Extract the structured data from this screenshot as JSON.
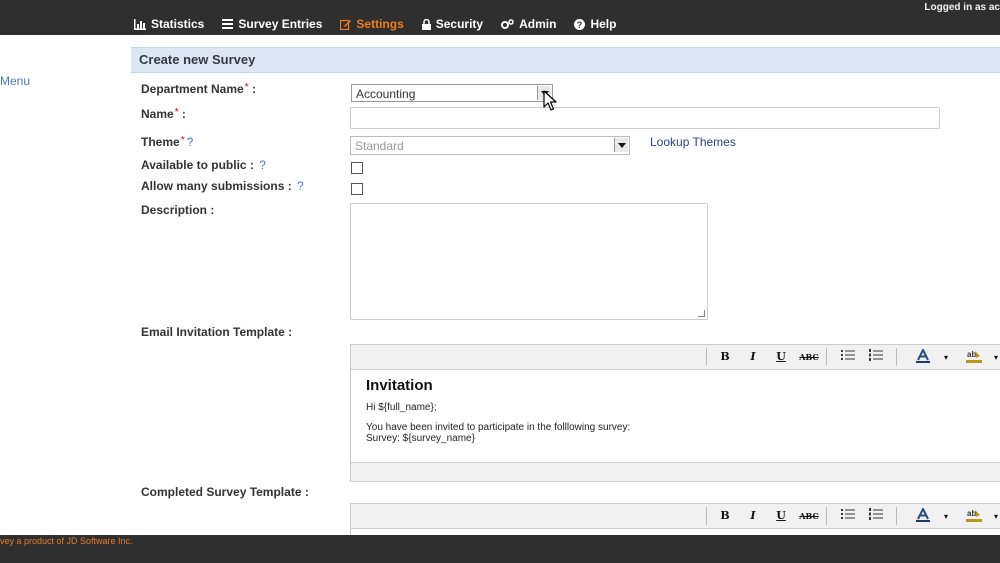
{
  "header": {
    "logged_in": "Logged in as ac",
    "nav": [
      {
        "label": "Statistics",
        "icon": "bar-chart-icon"
      },
      {
        "label": "Survey Entries",
        "icon": "list-icon"
      },
      {
        "label": "Settings",
        "icon": "edit-icon",
        "active": true
      },
      {
        "label": "Security",
        "icon": "lock-icon"
      },
      {
        "label": "Admin",
        "icon": "gears-icon"
      },
      {
        "label": "Help",
        "icon": "question-icon"
      }
    ],
    "active_color": "#f07d1a"
  },
  "sidebar": {
    "menu_label": "Menu"
  },
  "panel": {
    "title": "Create new Survey"
  },
  "form": {
    "department": {
      "label": "Department Name",
      "required": "*",
      "suffix": " :",
      "value": "Accounting"
    },
    "name": {
      "label": "Name",
      "required": "*",
      "suffix": " :",
      "value": ""
    },
    "theme": {
      "label": "Theme",
      "required": "*",
      "help": "?",
      "value": "Standard",
      "lookup": "Lookup Themes"
    },
    "public": {
      "label": "Available to public : ",
      "help": "?",
      "checked": false
    },
    "many": {
      "label": "Allow many submissions : ",
      "help": "?",
      "checked": false
    },
    "description": {
      "label": "Description :"
    },
    "email_template": {
      "label": "Email Invitation Template :"
    },
    "completed_template": {
      "label": "Completed Survey Template :"
    }
  },
  "toolbar": {
    "bold": "B",
    "italic": "I",
    "underline": "U",
    "strike": "ABC"
  },
  "email_editor": {
    "heading": "Invitation",
    "line1": "Hi ${full_name};",
    "line2": "You have been invited to participate in the folllowing survey:",
    "line3": "Survey: ${survey_name}"
  },
  "footer": {
    "text": "vey a product of JD Software Inc."
  }
}
